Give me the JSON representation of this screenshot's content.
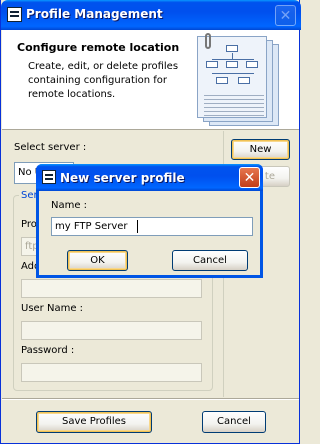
{
  "window": {
    "title": "Profile Management",
    "close_glyph": "✕"
  },
  "header": {
    "title": "Configure remote location",
    "description": "Create, edit, or delete profiles containing configuration for remote locations.",
    "art_icon": "document-diagram-icon"
  },
  "form": {
    "select_server_label": "Select server :",
    "server_combo_value": "No U",
    "group_legend": "Ser",
    "protocol_label": "Pro",
    "protocol_value": "ftp",
    "address_label": "Add",
    "username_label": "User Name :",
    "password_label": "Password :"
  },
  "buttons": {
    "new": "New",
    "delete": "te",
    "save_profiles": "Save Profiles",
    "cancel": "Cancel"
  },
  "dialog": {
    "title": "New server profile",
    "close_glyph": "✕",
    "name_label": "Name :",
    "name_value": "my FTP Server",
    "ok": "OK",
    "cancel": "Cancel"
  },
  "colors": {
    "titlebar": "#0053EE",
    "window_bg": "#ECE9D8",
    "dialog_close": "#C23D18"
  }
}
